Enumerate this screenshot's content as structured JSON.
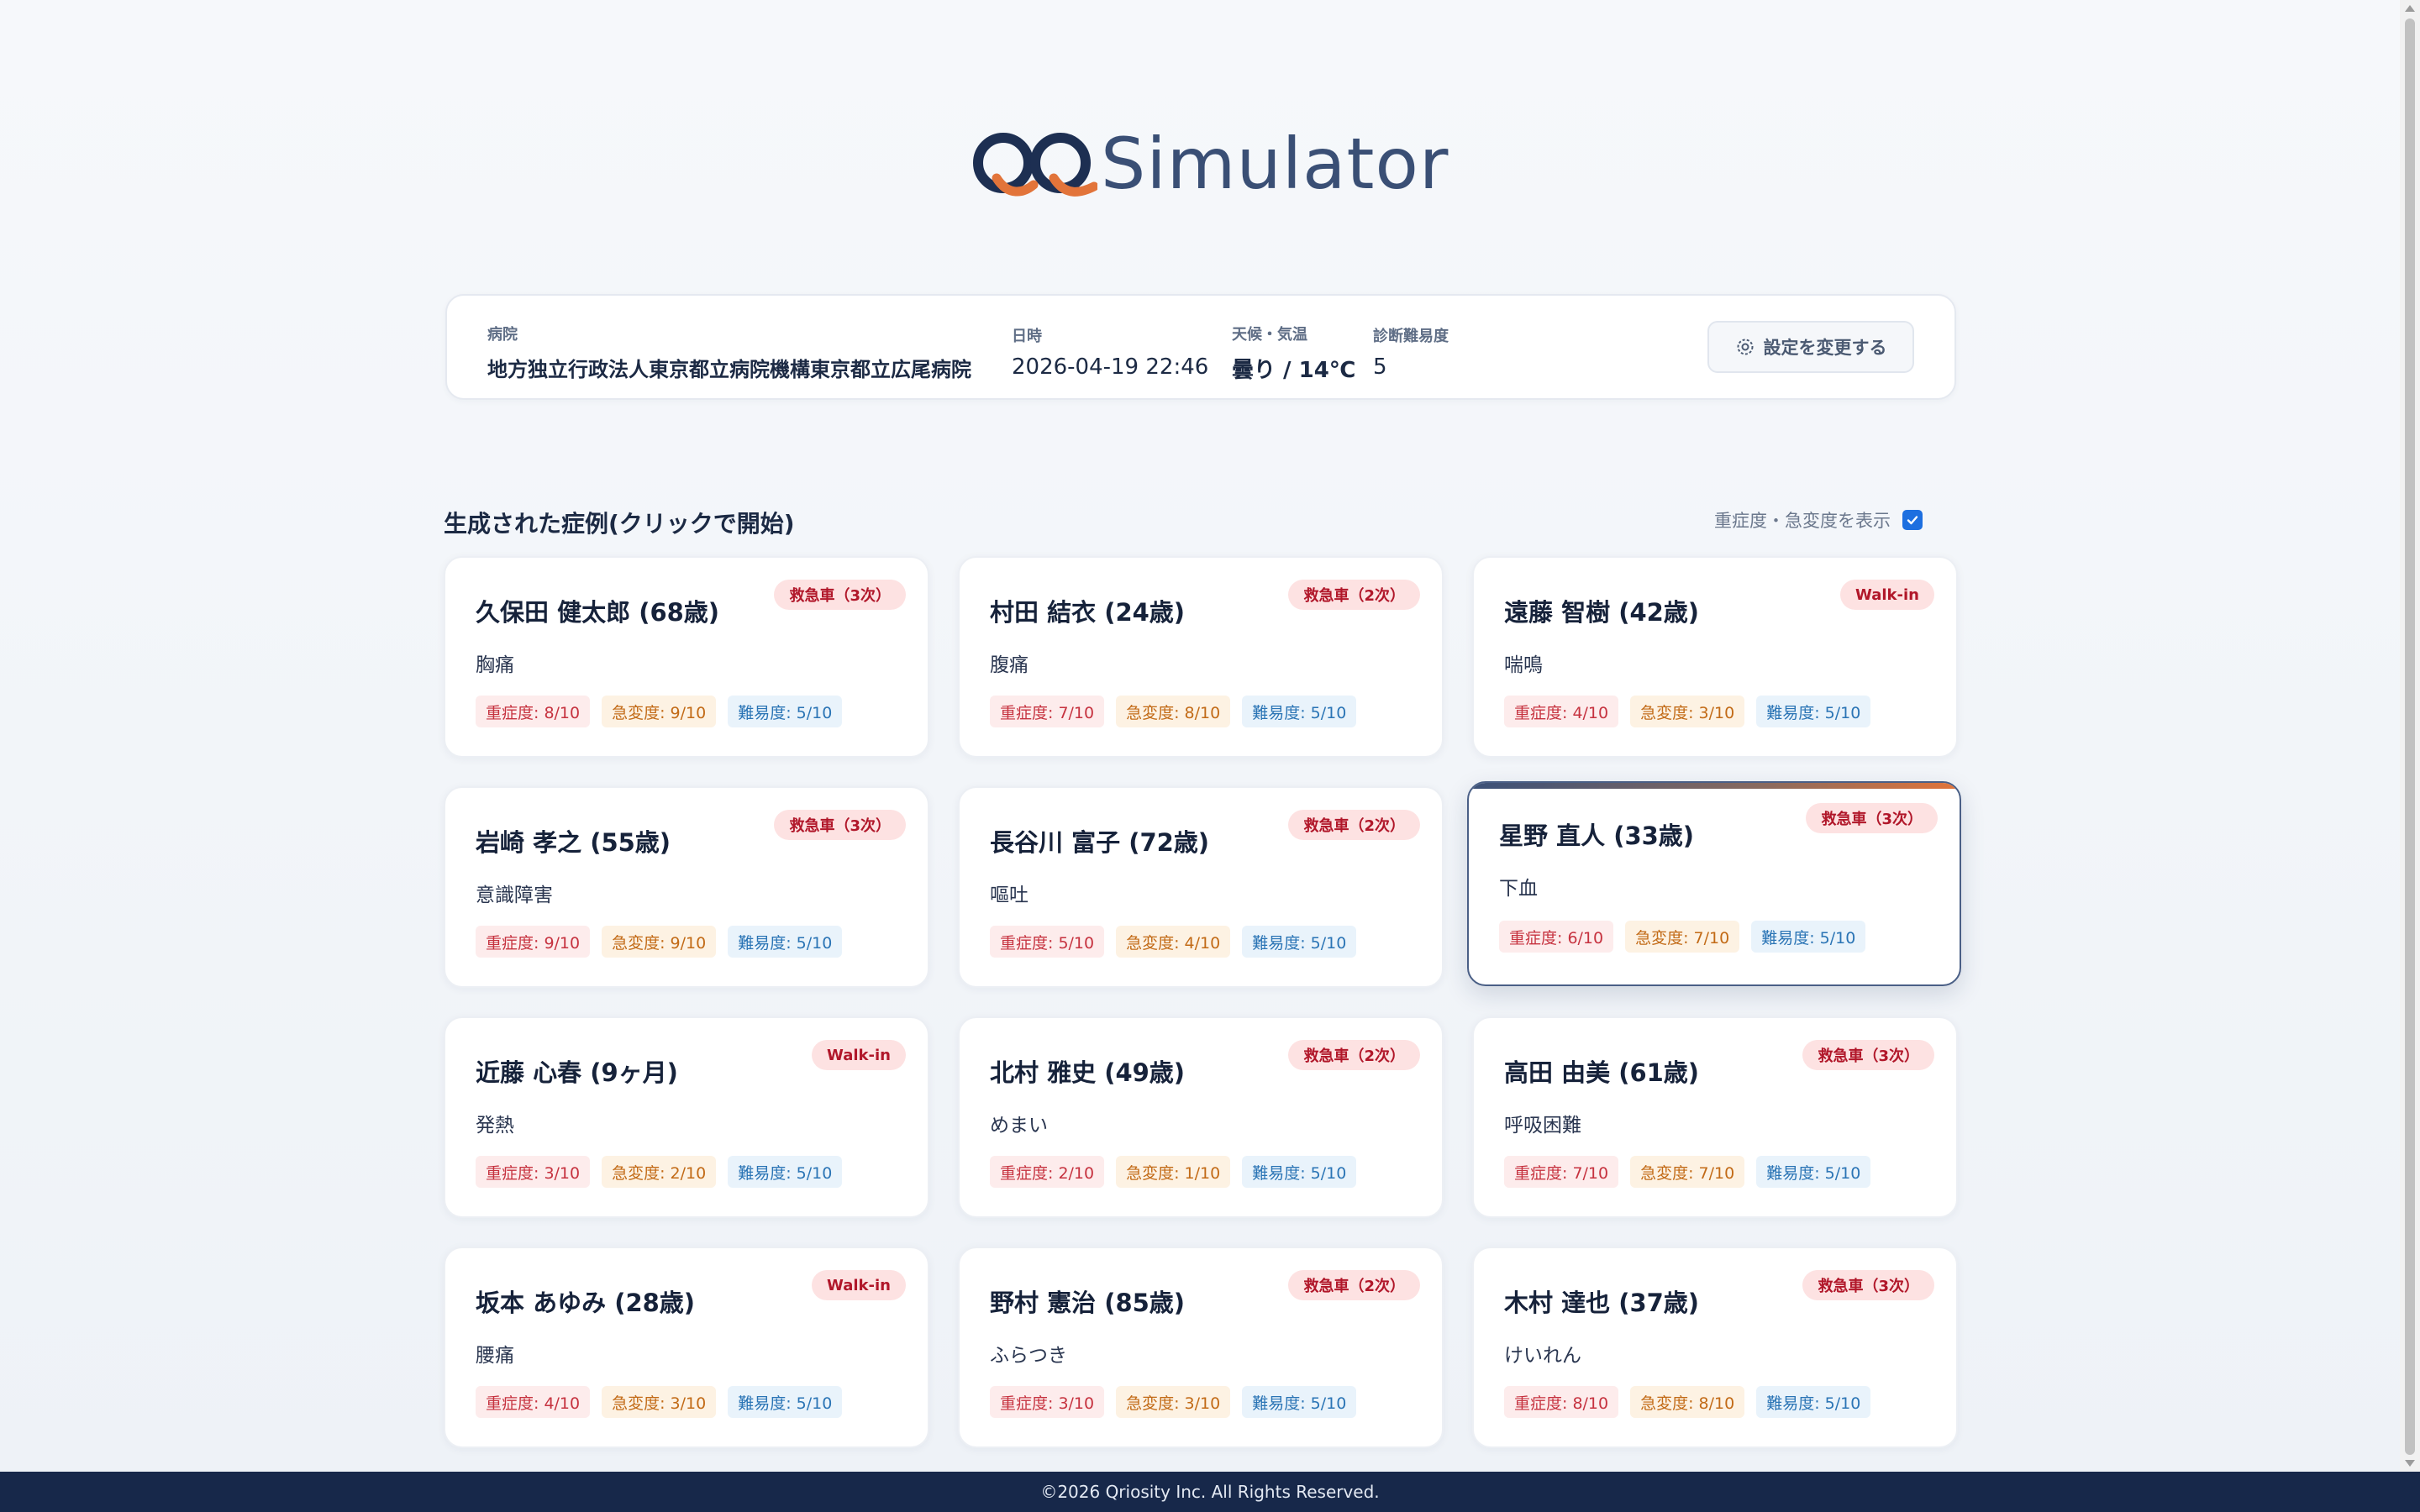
{
  "brand": {
    "name": "Simulator"
  },
  "info": {
    "hospital_label": "病院",
    "hospital": "地方独立行政法人東京都立病院機構東京都立広尾病院",
    "datetime_label": "日時",
    "datetime": "2026-04-19 22:46",
    "weather_label": "天候・気温",
    "weather": "曇り / 14℃",
    "difficulty_label": "診断難易度",
    "difficulty": "5",
    "settings_button": "設定を変更する"
  },
  "cases_section": {
    "title": "生成された症例(クリックで開始)",
    "toggle_label": "重症度・急変度を表示",
    "toggle_checked": true
  },
  "cases": [
    {
      "name": "久保田 健太郎 (68歳)",
      "complaint": "胸痛",
      "arrival": "救急車（3次）",
      "severity": "重症度: 8/10",
      "change": "急変度: 9/10",
      "difficulty": "難易度: 5/10"
    },
    {
      "name": "村田 結衣 (24歳)",
      "complaint": "腹痛",
      "arrival": "救急車（2次）",
      "severity": "重症度: 7/10",
      "change": "急変度: 8/10",
      "difficulty": "難易度: 5/10"
    },
    {
      "name": "遠藤 智樹 (42歳)",
      "complaint": "喘鳴",
      "arrival": "Walk-in",
      "severity": "重症度: 4/10",
      "change": "急変度: 3/10",
      "difficulty": "難易度: 5/10"
    },
    {
      "name": "岩崎 孝之 (55歳)",
      "complaint": "意識障害",
      "arrival": "救急車（3次）",
      "severity": "重症度: 9/10",
      "change": "急変度: 9/10",
      "difficulty": "難易度: 5/10"
    },
    {
      "name": "長谷川 富子 (72歳)",
      "complaint": "嘔吐",
      "arrival": "救急車（2次）",
      "severity": "重症度: 5/10",
      "change": "急変度: 4/10",
      "difficulty": "難易度: 5/10"
    },
    {
      "name": "星野 直人 (33歳)",
      "complaint": "下血",
      "arrival": "救急車（3次）",
      "severity": "重症度: 6/10",
      "change": "急変度: 7/10",
      "difficulty": "難易度: 5/10"
    },
    {
      "name": "近藤 心春 (9ヶ月)",
      "complaint": "発熱",
      "arrival": "Walk-in",
      "severity": "重症度: 3/10",
      "change": "急変度: 2/10",
      "difficulty": "難易度: 5/10"
    },
    {
      "name": "北村 雅史 (49歳)",
      "complaint": "めまい",
      "arrival": "救急車（2次）",
      "severity": "重症度: 2/10",
      "change": "急変度: 1/10",
      "difficulty": "難易度: 5/10"
    },
    {
      "name": "高田 由美 (61歳)",
      "complaint": "呼吸困難",
      "arrival": "救急車（3次）",
      "severity": "重症度: 7/10",
      "change": "急変度: 7/10",
      "difficulty": "難易度: 5/10"
    },
    {
      "name": "坂本 あゆみ (28歳)",
      "complaint": "腰痛",
      "arrival": "Walk-in",
      "severity": "重症度: 4/10",
      "change": "急変度: 3/10",
      "difficulty": "難易度: 5/10"
    },
    {
      "name": "野村 憲治 (85歳)",
      "complaint": "ふらつき",
      "arrival": "救急車（2次）",
      "severity": "重症度: 3/10",
      "change": "急変度: 3/10",
      "difficulty": "難易度: 5/10"
    },
    {
      "name": "木村 達也 (37歳)",
      "complaint": "けいれん",
      "arrival": "救急車（3次）",
      "severity": "重症度: 8/10",
      "change": "急変度: 8/10",
      "difficulty": "難易度: 5/10"
    }
  ],
  "footer": {
    "copyright": "©2026 Qriosity Inc. All Rights Reserved."
  },
  "colors": {
    "navy": "#1c2a44",
    "accent_orange": "#e2743a",
    "badge_red": "#b1172a",
    "checkbox_blue": "#1d6fe0",
    "footer_bg": "#17284a"
  }
}
